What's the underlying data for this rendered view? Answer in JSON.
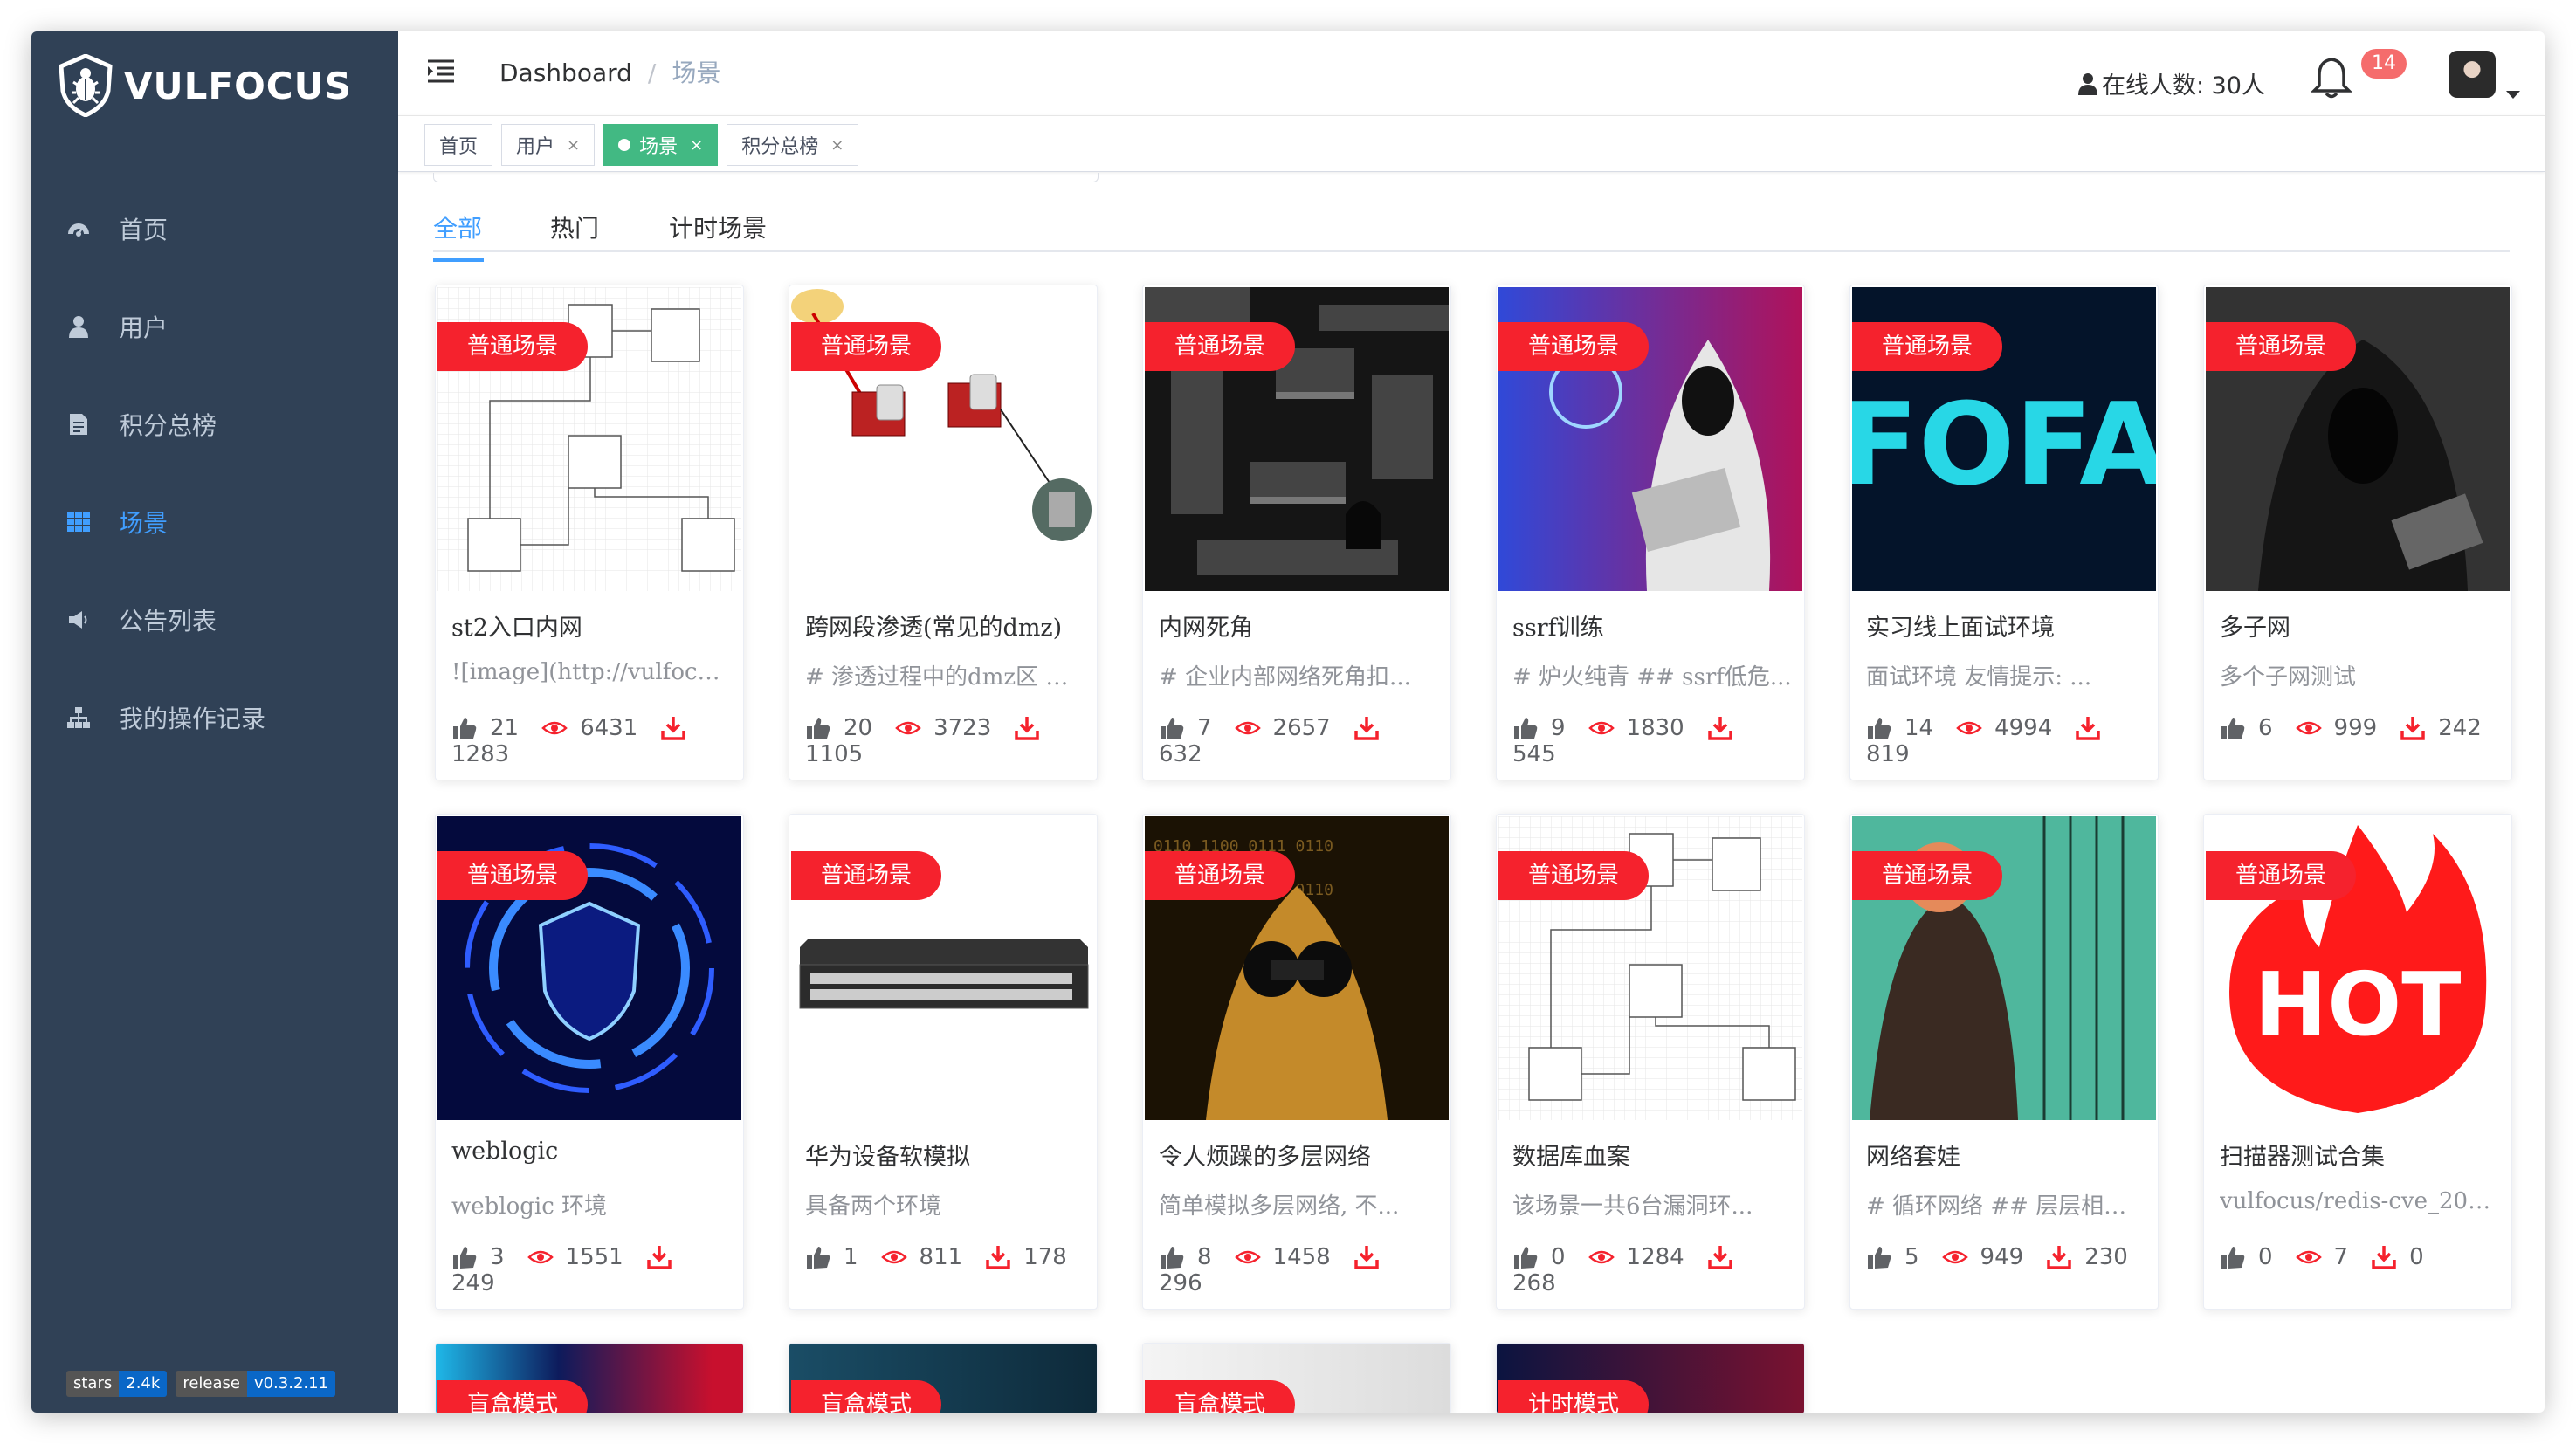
{
  "app": {
    "name": "VULFOCUS"
  },
  "sidebar": {
    "items": [
      {
        "label": "首页",
        "icon": "dashboard-icon"
      },
      {
        "label": "用户",
        "icon": "user-icon"
      },
      {
        "label": "积分总榜",
        "icon": "ranking-icon"
      },
      {
        "label": "场景",
        "icon": "grid-icon",
        "active": true
      },
      {
        "label": "公告列表",
        "icon": "megaphone-icon"
      },
      {
        "label": "我的操作记录",
        "icon": "sitemap-icon"
      }
    ],
    "badges": [
      {
        "left": "stars",
        "right": "2.4k"
      },
      {
        "left": "release",
        "right": "v0.3.2.11"
      }
    ]
  },
  "navbar": {
    "breadcrumb": [
      "Dashboard",
      "场景"
    ],
    "online": "在线人数: 30人",
    "notification_count": "14"
  },
  "tags": [
    {
      "label": "首页",
      "closable": false
    },
    {
      "label": "用户",
      "closable": true
    },
    {
      "label": "场景",
      "closable": true,
      "active": true
    },
    {
      "label": "积分总榜",
      "closable": true
    }
  ],
  "scene_tabs": [
    "全部",
    "热门",
    "计时场景"
  ],
  "ribbons": {
    "normal": "普通场景",
    "blind": "盲盒模式",
    "timed": "计时模式"
  },
  "cards": [
    {
      "title": "st2入口内网",
      "desc": "![image](http://vulfocus.c...",
      "likes": "21",
      "views": "6431",
      "downloads": "1283",
      "theme": "diagram"
    },
    {
      "title": "跨网段渗透(常见的dmz)",
      "desc": "# 渗透过程中的dmz区 #...",
      "likes": "20",
      "views": "3723",
      "downloads": "1105",
      "theme": "network"
    },
    {
      "title": "内网死角",
      "desc": "# 企业内部网络死角扣...",
      "likes": "7",
      "views": "2657",
      "downloads": "632",
      "theme": "maze"
    },
    {
      "title": "ssrf训练",
      "desc": "# 炉火纯青 ## ssrf低危...",
      "likes": "9",
      "views": "1830",
      "downloads": "545",
      "theme": "hacker"
    },
    {
      "title": "实习线上面试环境",
      "desc": "面试环境 友情提示: ...",
      "likes": "14",
      "views": "4994",
      "downloads": "819",
      "theme": "fofa"
    },
    {
      "title": "多子网",
      "desc": "多个子网测试",
      "likes": "6",
      "views": "999",
      "downloads": "242",
      "theme": "hood"
    },
    {
      "title": "weblogic",
      "desc": "weblogic 环境",
      "likes": "3",
      "views": "1551",
      "downloads": "249",
      "theme": "shield"
    },
    {
      "title": "华为设备软模拟",
      "desc": "具备两个环境",
      "likes": "1",
      "views": "811",
      "downloads": "178",
      "theme": "switch"
    },
    {
      "title": "令人烦躁的多层网络",
      "desc": "简单模拟多层网络, 不...",
      "likes": "8",
      "views": "1458",
      "downloads": "296",
      "theme": "binoculars"
    },
    {
      "title": "数据库血案",
      "desc": "该场景一共6台漏洞环...",
      "likes": "0",
      "views": "1284",
      "downloads": "268",
      "theme": "diagram2"
    },
    {
      "title": "网络套娃",
      "desc": "# 循环网络 ## 层层相通...",
      "likes": "5",
      "views": "949",
      "downloads": "230",
      "theme": "comic"
    },
    {
      "title": "扫描器测试合集",
      "desc": "vulfocus/redis-cve_2022...",
      "likes": "0",
      "views": "7",
      "downloads": "0",
      "theme": "hot"
    }
  ],
  "partial_cards": [
    {
      "ribbon": "盲盒模式"
    },
    {
      "ribbon": "盲盒模式"
    },
    {
      "ribbon": "盲盒模式"
    },
    {
      "ribbon": "计时模式"
    }
  ],
  "hot_text": "HOT",
  "fofa_text": "FOFA",
  "colors": {
    "sidebar": "#304156",
    "accent": "#409eff",
    "ribbon": "#f5222d",
    "tag_active": "#42b983"
  }
}
